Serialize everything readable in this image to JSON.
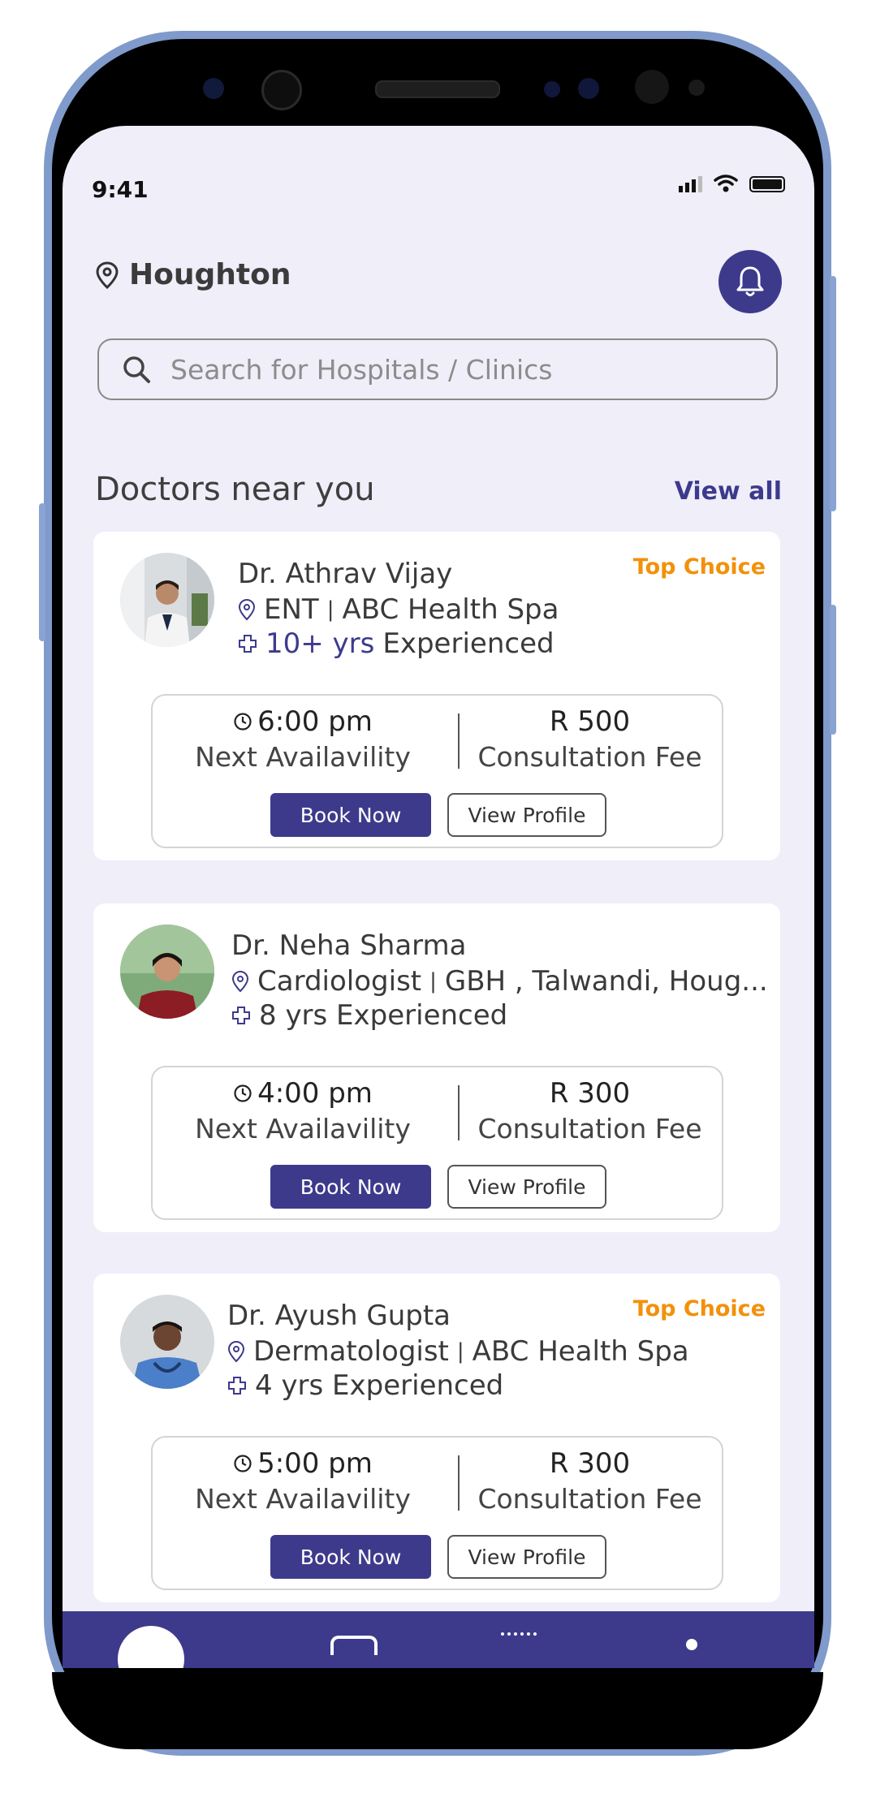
{
  "status_bar": {
    "time": "9:41"
  },
  "header": {
    "location": "Houghton"
  },
  "search": {
    "placeholder": "Search for Hospitals / Clinics"
  },
  "section": {
    "title": "Doctors near you",
    "view_all": "View all"
  },
  "doctors": [
    {
      "badge": "Top Choice",
      "name": "Dr. Athrav Vijay",
      "specialty": "ENT",
      "hospital": "ABC Health Spa",
      "experience_highlight": "10+ yrs",
      "experience_suffix": "Experienced",
      "time": "6:00 pm",
      "avail_label": "Next Availavility",
      "fee": "R 500",
      "fee_label": "Consultation Fee",
      "book_label": "Book Now",
      "profile_label": "View Profile"
    },
    {
      "badge": "",
      "name": "Dr. Neha Sharma",
      "specialty": "Cardiologist",
      "hospital": "GBH , Talwandi, Houg...",
      "experience_highlight": "",
      "experience_suffix": "8 yrs Experienced",
      "time": "4:00 pm",
      "avail_label": "Next Availavility",
      "fee": "R 300",
      "fee_label": "Consultation Fee",
      "book_label": "Book Now",
      "profile_label": "View Profile"
    },
    {
      "badge": "Top Choice",
      "name": "Dr. Ayush Gupta",
      "specialty": "Dermatologist",
      "hospital": "ABC Health Spa",
      "experience_highlight": "",
      "experience_suffix": "4 yrs Experienced",
      "time": "5:00 pm",
      "avail_label": "Next Availavility",
      "fee": "R 300",
      "fee_label": "Consultation Fee",
      "book_label": "Book Now",
      "profile_label": "View Profile"
    }
  ],
  "colors": {
    "primary": "#3d3a8c",
    "badge": "#f2910a",
    "background": "#efeef9"
  },
  "icons": [
    "location-pin-icon",
    "bell-icon",
    "search-icon",
    "clock-icon",
    "cross-icon",
    "signal-icon",
    "wifi-icon",
    "battery-icon"
  ]
}
